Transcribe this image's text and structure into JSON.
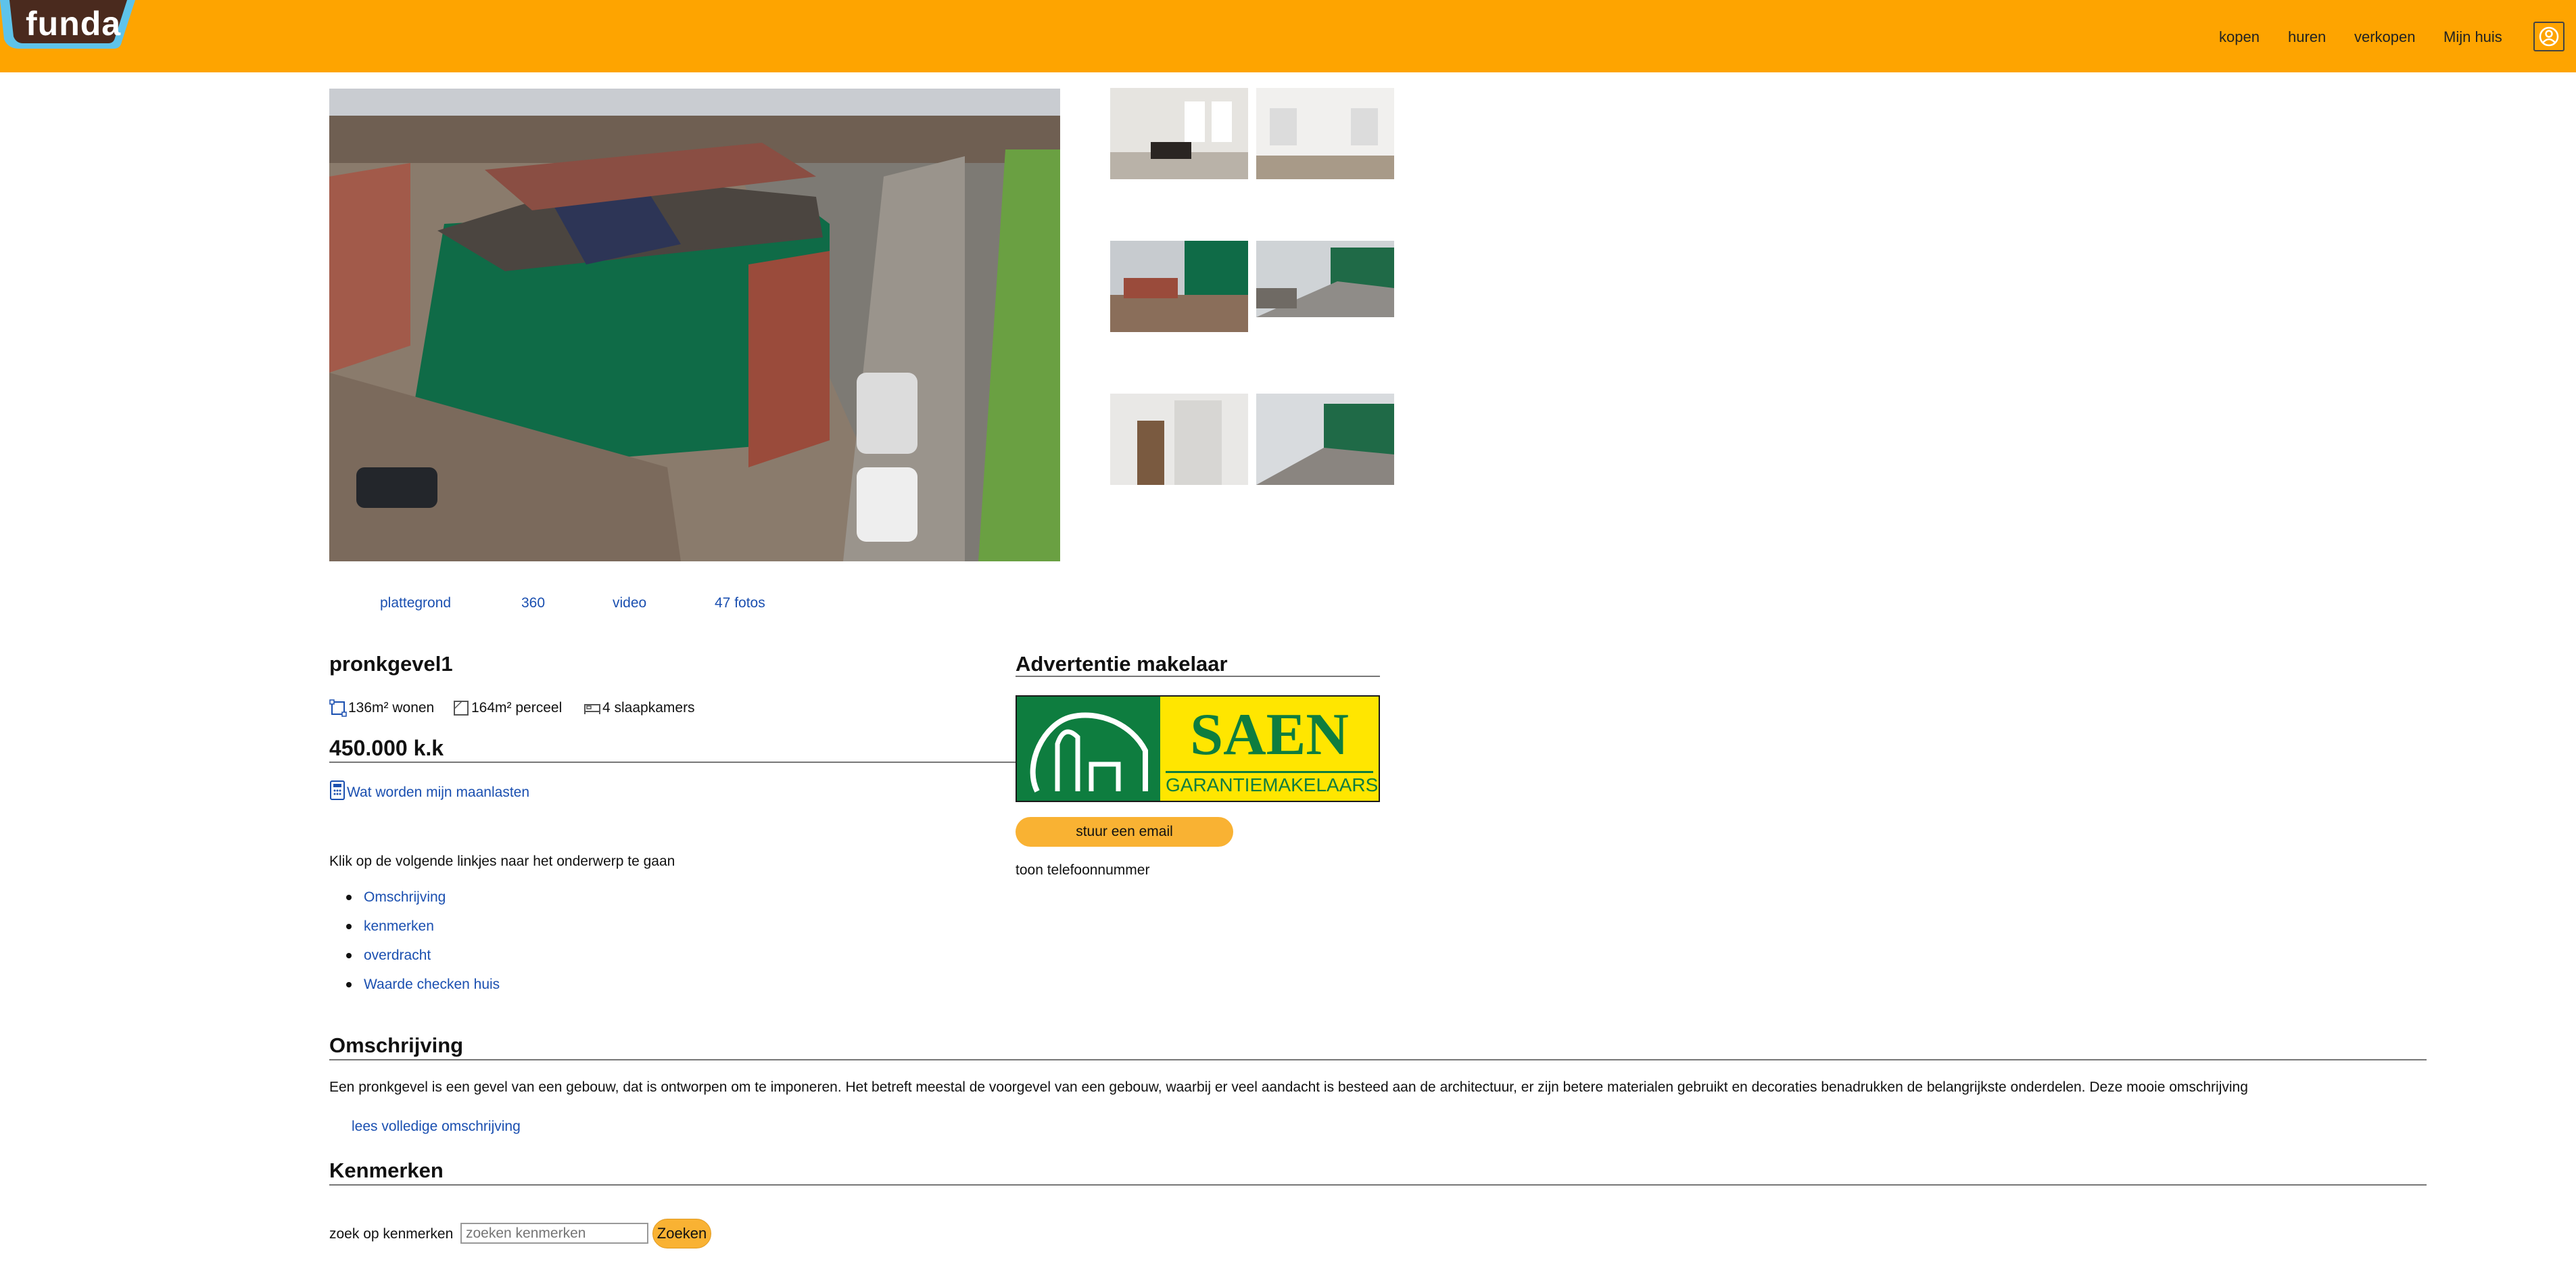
{
  "header": {
    "logo_text": "funda",
    "nav": [
      "kopen",
      "huren",
      "verkopen",
      "Mijn huis"
    ],
    "account_icon": "user-circle-icon",
    "bg_color": "#fea400"
  },
  "media": {
    "links": [
      "plattegrond",
      "360",
      "video",
      "47 fotos"
    ]
  },
  "listing": {
    "title": "pronkgevel1",
    "features": [
      {
        "icon": "floor-area-icon",
        "text": "136m² wonen"
      },
      {
        "icon": "plot-area-icon",
        "text": "164m² perceel"
      },
      {
        "icon": "bed-icon",
        "text": "4 slaapkamers"
      }
    ],
    "price": "450.000 k.k",
    "costs_link": "Wat worden mijn maanlasten",
    "intro": "Klik op de volgende linkjes naar het onderwerp te gaan",
    "toc": [
      "Omschrijving",
      "kenmerken",
      "overdracht",
      "Waarde checken huis"
    ]
  },
  "agent": {
    "title": "Advertentie makelaar",
    "logo_name": "SAEN",
    "logo_sub": "GARANTIEMAKELAARS",
    "email_button": "stuur een email",
    "phone_link": "toon telefoonnummer"
  },
  "description": {
    "title": "Omschrijving",
    "text": "Een pronkgevel is een gevel van een gebouw, dat is ontworpen om te imponeren. Het betreft meestal de voorgevel van een gebouw, waarbij er veel aandacht is besteed aan de architectuur, er zijn betere materialen gebruikt en decoraties benadrukken de belangrijkste onderdelen. Deze mooie omschrijving",
    "more_link": "lees volledige omschrijving"
  },
  "kenmerken": {
    "title": "Kenmerken",
    "search_label": "zoek op kenmerken",
    "search_placeholder": "zoeken kenmerken",
    "search_button": "Zoeken"
  }
}
